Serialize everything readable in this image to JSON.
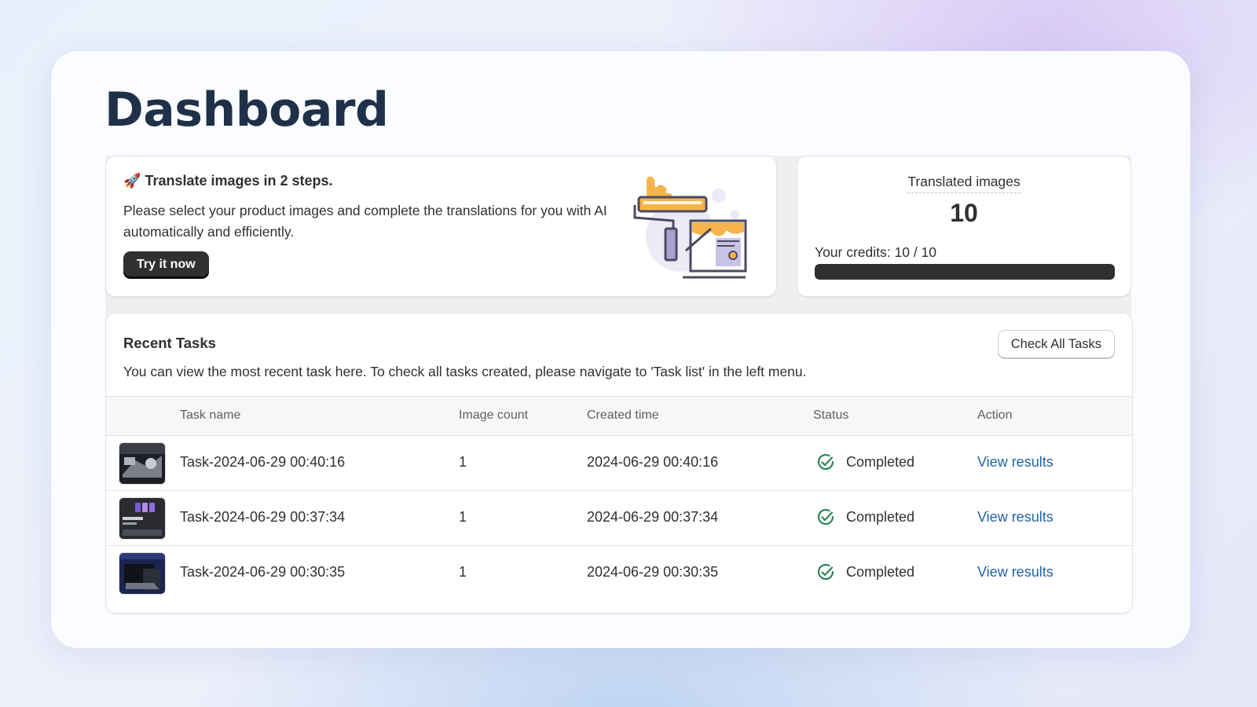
{
  "page": {
    "title": "Dashboard"
  },
  "promo": {
    "emoji": "🚀",
    "title": "Translate images in 2 steps.",
    "description": "Please select your product images and complete the translations for you with AI automatically and efficiently.",
    "button_label": "Try it now",
    "illustration": "paint-roller-illustration"
  },
  "credits": {
    "label": "Translated images",
    "count": "10",
    "credits_text": "Your credits: 10 / 10",
    "credits_used_fraction": 1.0
  },
  "recent_tasks": {
    "title": "Recent Tasks",
    "description": "You can view the most recent task here. To check all tasks created, please navigate to 'Task list' in the left menu.",
    "check_all_label": "Check All Tasks",
    "columns": [
      "Task name",
      "Image count",
      "Created time",
      "Status",
      "Action"
    ],
    "rows": [
      {
        "name": "Task-2024-06-29 00:40:16",
        "image_count": "1",
        "created": "2024-06-29 00:40:16",
        "status": "Completed",
        "action": "View results",
        "thumb": "product-thumbnail"
      },
      {
        "name": "Task-2024-06-29 00:37:34",
        "image_count": "1",
        "created": "2024-06-29 00:37:34",
        "status": "Completed",
        "action": "View results",
        "thumb": "product-thumbnail"
      },
      {
        "name": "Task-2024-06-29 00:30:35",
        "image_count": "1",
        "created": "2024-06-29 00:30:35",
        "status": "Completed",
        "action": "View results",
        "thumb": "product-thumbnail"
      }
    ]
  },
  "colors": {
    "primary_text": "#303030",
    "title": "#1f3148",
    "link": "#2463a4",
    "success": "#29845a",
    "accent_illustration": "#f6b44a"
  }
}
